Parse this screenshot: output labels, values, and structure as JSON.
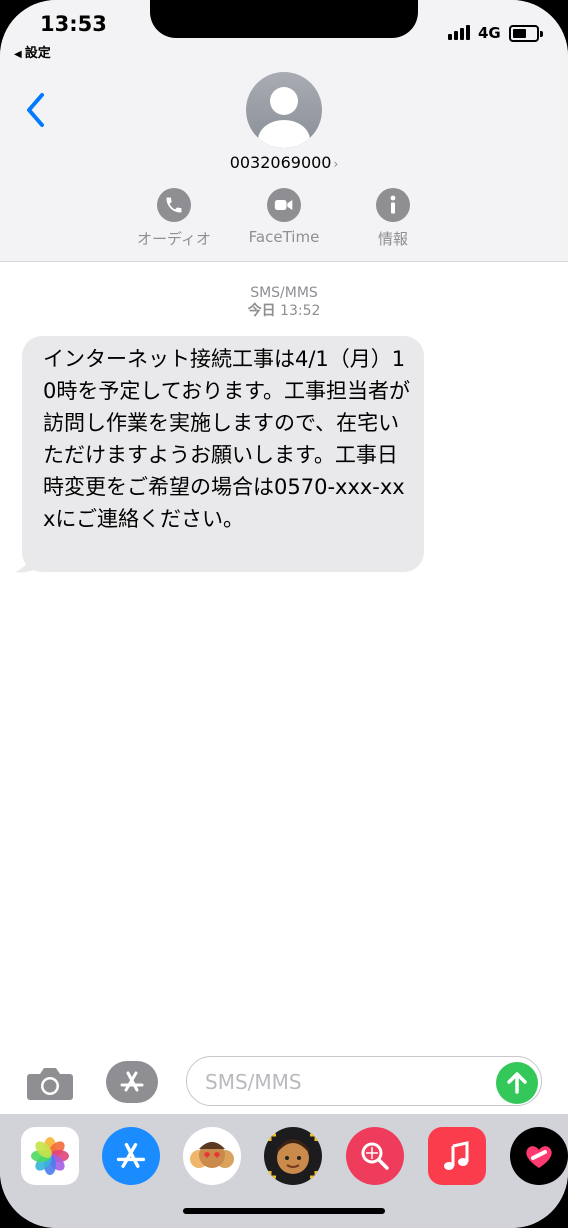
{
  "status_bar": {
    "time": "13:53",
    "back_app": "設定",
    "network": "4G"
  },
  "header": {
    "contact_number": "0032069000",
    "actions": [
      {
        "label": "オーディオ",
        "icon": "phone-icon"
      },
      {
        "label": "FaceTime",
        "icon": "video-icon"
      },
      {
        "label": "情報",
        "icon": "info-icon"
      }
    ]
  },
  "conversation": {
    "service": "SMS/MMS",
    "day": "今日",
    "time": "13:52",
    "messages": [
      {
        "direction": "incoming",
        "text": "インターネット接続工事は4/1（月）10時を予定しております。工事担当者が訪問し作業を実施しますので、在宅いただけますようお願いします。工事日時変更をご希望の場合は0570-xxx-xxxにご連絡ください。"
      }
    ]
  },
  "composer": {
    "placeholder": "SMS/MMS"
  },
  "app_drawer": [
    {
      "name": "photos-app-icon"
    },
    {
      "name": "app-store-icon"
    },
    {
      "name": "memoji-stickers-icon"
    },
    {
      "name": "animoji-icon"
    },
    {
      "name": "image-search-icon"
    },
    {
      "name": "music-app-icon"
    },
    {
      "name": "digital-touch-icon"
    }
  ],
  "colors": {
    "accent": "#007aff",
    "send": "#34c759",
    "bubble": "#e9e9eb",
    "header_bg": "#f3f3f5"
  }
}
